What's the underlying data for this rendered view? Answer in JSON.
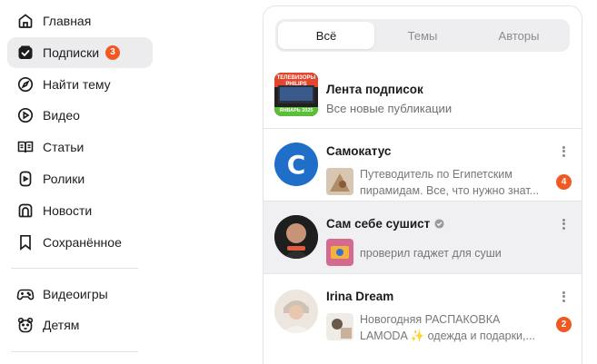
{
  "sidebar": {
    "items": [
      {
        "label": "Главная",
        "icon": "home-icon"
      },
      {
        "label": "Подписки",
        "icon": "subscriptions-icon",
        "badge": "3",
        "active": true
      },
      {
        "label": "Найти тему",
        "icon": "compass-icon"
      },
      {
        "label": "Видео",
        "icon": "video-play-icon"
      },
      {
        "label": "Статьи",
        "icon": "book-icon"
      },
      {
        "label": "Ролики",
        "icon": "shorts-icon"
      },
      {
        "label": "Новости",
        "icon": "news-icon"
      },
      {
        "label": "Сохранённое",
        "icon": "bookmark-icon"
      }
    ],
    "extra_items": [
      {
        "label": "Видеоигры",
        "icon": "gamepad-icon"
      },
      {
        "label": "Детям",
        "icon": "bear-icon"
      }
    ]
  },
  "tabs": [
    {
      "label": "Всё",
      "active": true
    },
    {
      "label": "Темы",
      "active": false
    },
    {
      "label": "Авторы",
      "active": false
    }
  ],
  "feed": {
    "title": "Лента подписок",
    "subtitle": "Все новые публикации",
    "cover": {
      "line1": "ТЕЛЕВИЗОРЫ",
      "line2": "PHILIPS",
      "line3": "ЯНВАРЬ 2025"
    }
  },
  "channels": [
    {
      "name": "Самокатус",
      "avatar_letter": "C",
      "avatar_color": "#1f6fc9",
      "snippet_line1": "Путеводитель по Египетским",
      "snippet_line2": "пирамидам. Все, что нужно знат...",
      "count": "4",
      "verified": false
    },
    {
      "name": "Сам себе сушист",
      "verified": true,
      "snippet_line1": "проверил гаджет для суши",
      "count": null
    },
    {
      "name": "Irina Dream",
      "verified": false,
      "snippet_line1": "Новогодняя РАСПАКОВКА",
      "snippet_line2": "LAMODA ✨ одежда и подарки,...",
      "count": "2"
    }
  ],
  "colors": {
    "accent": "#f05a22",
    "hover_bg": "#f0f0f2",
    "active_nav_bg": "#ececee"
  }
}
